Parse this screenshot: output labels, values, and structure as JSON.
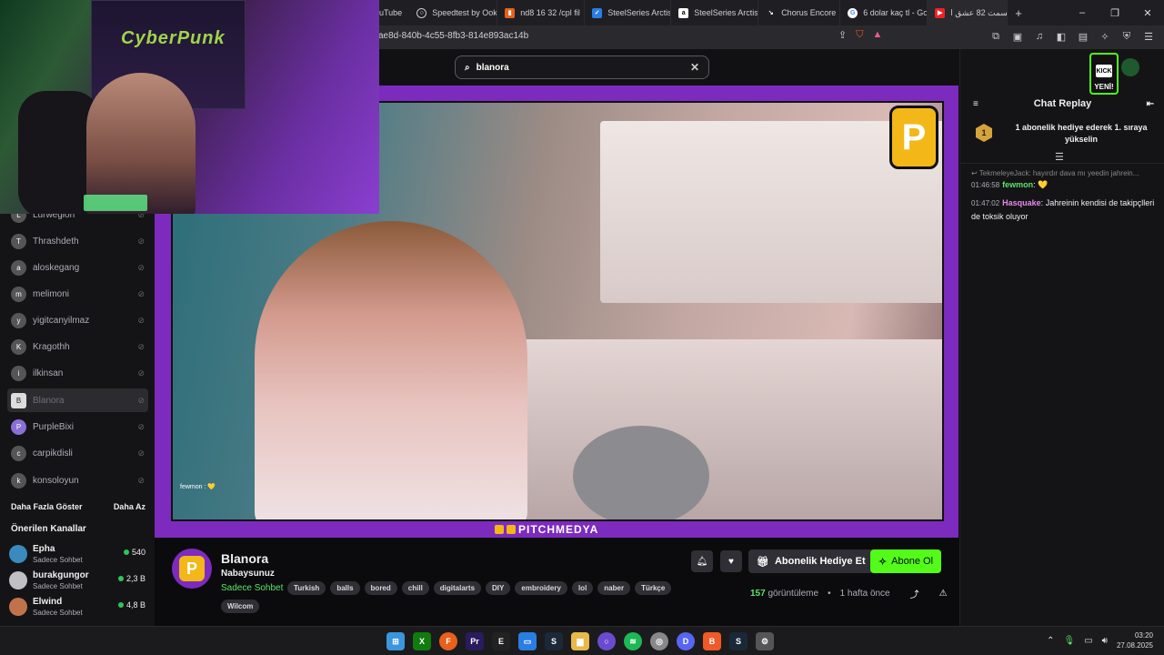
{
  "browser": {
    "tabs": [
      {
        "label": "uTube",
        "icon": "youtube-icon",
        "color": "#1f1f23"
      },
      {
        "label": "Speedtest by Ookl",
        "icon": "speedtest-icon",
        "color": "#3a3a40"
      },
      {
        "label": "nd8 16 32 /cpl fil",
        "icon": "page-icon",
        "color": "#e8601c"
      },
      {
        "label": "SteelSeries Arctis",
        "icon": "shield-check-icon",
        "color": "#2a7de1"
      },
      {
        "label": "SteelSeries Arctis",
        "icon": "amazon-icon",
        "color": "#333"
      },
      {
        "label": "Chorus Encore",
        "icon": "arrow-icon",
        "color": "#444"
      },
      {
        "label": "6 dolar kaç tl - Go",
        "icon": "google-icon",
        "color": "#fff"
      },
      {
        "label": "قسمت 82 عشق ا",
        "icon": "youtube-icon",
        "color": "#e22"
      }
    ],
    "new_tab": "+",
    "window": {
      "minimize": "–",
      "restore": "❐",
      "close": "✕"
    },
    "url": "ae8d-840b-4c55-8fb3-814e893ac14b"
  },
  "search": {
    "value": "blanora",
    "clear": "✕"
  },
  "sidebar": {
    "followed": [
      {
        "name": "Lurwegion",
        "avatar": "L"
      },
      {
        "name": "Thrashdeth",
        "avatar": "T"
      },
      {
        "name": "aloskegang",
        "avatar": "a"
      },
      {
        "name": "melimoni",
        "avatar": "m"
      },
      {
        "name": "yigitcanyilmaz",
        "avatar": "y"
      },
      {
        "name": "Kragothh",
        "avatar": "K"
      },
      {
        "name": "ilkinsan",
        "avatar": "i"
      },
      {
        "name": "Blanora",
        "avatar": "B"
      },
      {
        "name": "PurpleBixi",
        "avatar": "P"
      },
      {
        "name": "carpikdisli",
        "avatar": "c"
      },
      {
        "name": "konsoloyun",
        "avatar": "k"
      }
    ],
    "show_more": "Daha Fazla Göster",
    "show_less": "Daha Az",
    "recommended_title": "Önerilen Kanallar",
    "recommended": [
      {
        "name": "Epha",
        "category": "Sadece Sohbet",
        "viewers": "540"
      },
      {
        "name": "burakgungor",
        "category": "Sadece Sohbet",
        "viewers": "2,3 B"
      },
      {
        "name": "Elwind",
        "category": "Sadece Sohbet",
        "viewers": "4,8 B"
      }
    ]
  },
  "video": {
    "overlay_chat": "fewmon : 💛",
    "brand_logo": "P",
    "watermark": "PITCHMEDYA"
  },
  "channel": {
    "name": "Blanora",
    "title": "Nabaysunuz",
    "category": "Sadece Sohbet",
    "tags": [
      "Turkish",
      "balls",
      "bored",
      "chill",
      "digitalarts",
      "DIY",
      "embroidery",
      "lol",
      "naber",
      "Türkçe"
    ],
    "extra_tag": "Wilcom",
    "gift_label": "Abonelik Hediye Et",
    "subscribe_label": "Abone Ol",
    "view_count": "157",
    "views_label": "görüntüleme",
    "time_ago": "1 hafta önce"
  },
  "chat": {
    "title": "Chat Replay",
    "badge_rank": "1",
    "sub_banner": "1 abonelik hediye ederek 1. sıraya yükselin",
    "reply_line": "↩ TekmeleyeJack: hayırdır dava mı yeedin jahrein...",
    "messages": [
      {
        "time": "01:46:58",
        "user": "fewmon",
        "text": "💛"
      },
      {
        "time": "01:47:02",
        "user": "Hasquake",
        "text": "Jahreinin kendisi de takipçlleri de toksik oluyor"
      }
    ]
  },
  "kick_new": "YENİ!",
  "taskbar": {
    "apps": [
      "windows",
      "xbox",
      "firefox",
      "premiere",
      "epic",
      "remote",
      "steam",
      "files",
      "search",
      "spotify",
      "chrome",
      "discord",
      "brave",
      "steam2",
      "settings"
    ],
    "time": "03:20",
    "date": "27.08.2025"
  }
}
